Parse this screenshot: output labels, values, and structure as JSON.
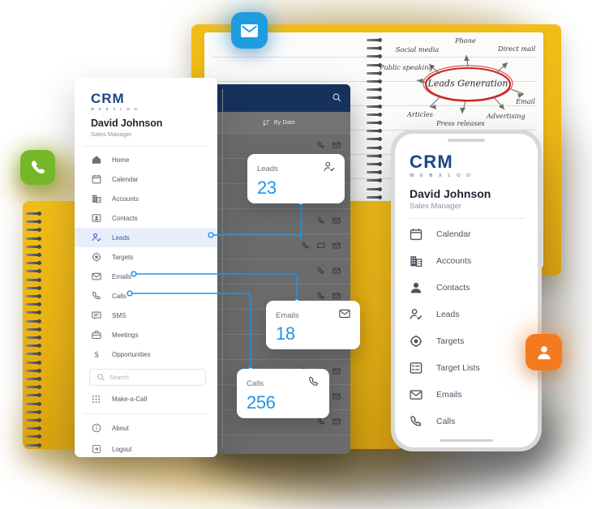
{
  "brand": {
    "name": "CRM",
    "sub": "W E B X L O O"
  },
  "user": {
    "name": "David Johnson",
    "role": "Sales Manager"
  },
  "desktop_sidebar": {
    "items": [
      {
        "label": "Home",
        "icon": "home-icon"
      },
      {
        "label": "Calendar",
        "icon": "calendar-icon"
      },
      {
        "label": "Accounts",
        "icon": "building-icon"
      },
      {
        "label": "Contacts",
        "icon": "contact-card-icon"
      },
      {
        "label": "Leads",
        "icon": "lead-person-check-icon"
      },
      {
        "label": "Targets",
        "icon": "target-icon"
      },
      {
        "label": "Emails",
        "icon": "envelope-icon"
      },
      {
        "label": "Calls",
        "icon": "phone-icon"
      },
      {
        "label": "SMS",
        "icon": "chat-bubble-icon"
      },
      {
        "label": "Meetings",
        "icon": "briefcase-icon"
      },
      {
        "label": "Opportunities",
        "icon": "dollar-icon"
      }
    ],
    "active": "Leads",
    "search": {
      "placeholder": "Search",
      "icon": "search-icon"
    },
    "make_a_call": {
      "label": "Make-a-Call",
      "icon": "dialpad-icon"
    },
    "footer": [
      {
        "label": "About",
        "icon": "info-icon"
      },
      {
        "label": "Logout",
        "icon": "logout-icon"
      }
    ]
  },
  "leads_table": {
    "sort": {
      "label": "By Date",
      "icon": "sort-icon"
    },
    "search_icon": "search-icon",
    "row_icons": [
      "phone-icon",
      "chat-icon",
      "envelope-icon"
    ],
    "row_count": 12
  },
  "stat_cards": [
    {
      "label": "Leads",
      "value": "23",
      "icon": "lead-person-check-icon"
    },
    {
      "label": "Emails",
      "value": "18",
      "icon": "envelope-icon"
    },
    {
      "label": "Calls",
      "value": "256",
      "icon": "phone-icon"
    }
  ],
  "phone_menu": {
    "items": [
      {
        "label": "Calendar",
        "icon": "calendar-icon"
      },
      {
        "label": "Accounts",
        "icon": "building-icon"
      },
      {
        "label": "Contacts",
        "icon": "person-icon"
      },
      {
        "label": "Leads",
        "icon": "lead-person-check-icon"
      },
      {
        "label": "Targets",
        "icon": "target-icon"
      },
      {
        "label": "Target Lists",
        "icon": "list-icon"
      },
      {
        "label": "Emails",
        "icon": "envelope-icon"
      },
      {
        "label": "Calls",
        "icon": "phone-icon"
      }
    ]
  },
  "mindmap": {
    "center": "Leads Generation",
    "nodes": [
      "Social media",
      "Phone",
      "Direct mail",
      "Public speaking",
      "Email",
      "Articles",
      "Press releases",
      "Advertising"
    ]
  },
  "badges": [
    {
      "name": "mail-app-badge",
      "icon": "envelope-icon"
    },
    {
      "name": "phone-app-badge",
      "icon": "phone-icon"
    },
    {
      "name": "contact-app-badge",
      "icon": "person-icon"
    }
  ],
  "colors": {
    "brand_blue": "#1c4586",
    "accent_blue": "#1e95e8",
    "notebook_yellow": "#e9b314",
    "table_dark": "#6b6b6b",
    "header_navy": "#16315c",
    "mail_badge": "#1e9ce0",
    "phone_badge": "#76b72a",
    "contact_badge": "#f47a20",
    "mindmap_red": "#cc2222"
  }
}
